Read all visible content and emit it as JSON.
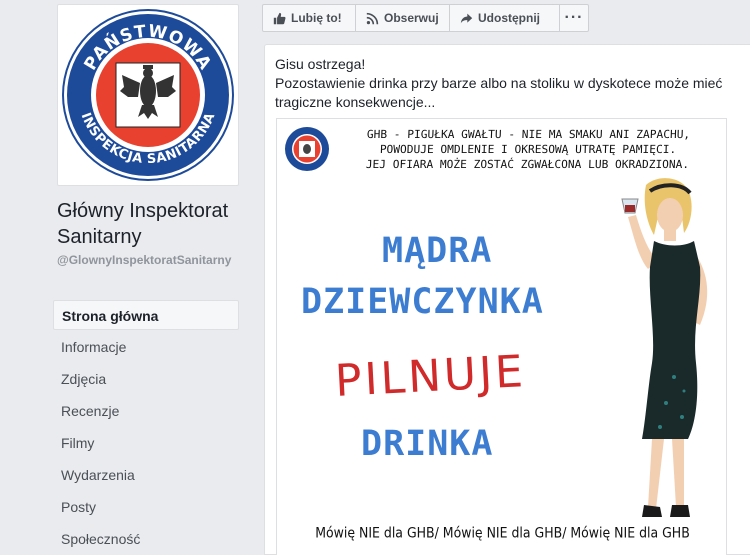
{
  "page": {
    "name": "Główny Inspektorat Sanitarny",
    "handle": "@GlownyInspektoratSanitarny",
    "logo_text_top": "PAŃSTWOWA",
    "logo_text_bottom": "INSPEKCJA SANITARNA"
  },
  "nav": {
    "items": [
      {
        "label": "Strona główna",
        "active": true
      },
      {
        "label": "Informacje"
      },
      {
        "label": "Zdjęcia"
      },
      {
        "label": "Recenzje"
      },
      {
        "label": "Filmy"
      },
      {
        "label": "Wydarzenia"
      },
      {
        "label": "Posty"
      },
      {
        "label": "Społeczność"
      }
    ]
  },
  "actions": {
    "like": "Lubię to!",
    "follow": "Obserwuj",
    "share": "Udostępnij",
    "more": "···"
  },
  "post": {
    "line1": "Gisu ostrzega!",
    "line2": "Pozostawienie drinka przy barze albo na stoliku w dyskotece może mieć tragiczne konsekwencje...",
    "image": {
      "warning_1": "GHB - PIGUŁKA GWAŁTU - NIE MA SMAKU ANI ZAPACHU,",
      "warning_2": "POWODUJE OMDLENIE I OKRESOWĄ UTRATĘ PAMIĘCI.",
      "warning_3": "JEJ OFIARA MOŻE ZOSTAĆ ZGWAŁCONA LUB OKRADZIONA.",
      "headline_1": "MĄDRA",
      "headline_2": "DZIEWCZYNKA",
      "headline_3": "PILNUJE",
      "headline_4": "DRINKA",
      "footer": "Mówię NIE dla GHB/ Mówię NIE dla GHB/ Mówię NIE dla GHB"
    }
  },
  "colors": {
    "brand_red": "#e8412f",
    "brand_blue": "#1e4a9a",
    "headline_blue": "#3d7dd1",
    "headline_red": "#d02a2a"
  }
}
